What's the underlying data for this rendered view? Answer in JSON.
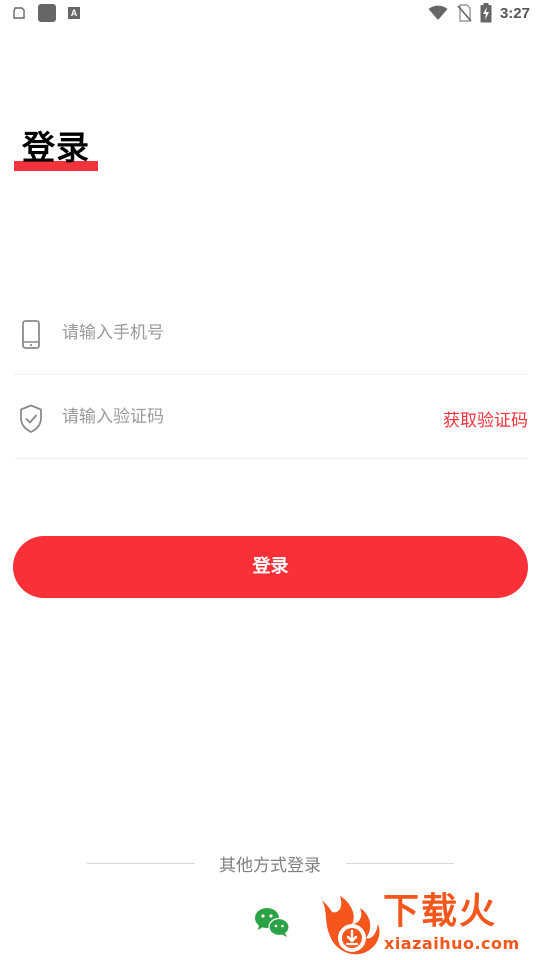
{
  "status_bar": {
    "time": "3:27",
    "left_icons": [
      "sd-card-icon",
      "app-square-icon",
      "font-a-icon"
    ],
    "right_icons": [
      "wifi-icon",
      "no-sim-icon",
      "battery-charging-icon"
    ],
    "a_glyph": "A"
  },
  "page": {
    "title": "登录",
    "accent_color": "#f4323c"
  },
  "form": {
    "phone": {
      "placeholder": "请输入手机号",
      "value": "",
      "icon": "phone-icon"
    },
    "code": {
      "placeholder": "请输入验证码",
      "value": "",
      "icon": "shield-check-icon",
      "get_code_label": "获取验证码"
    },
    "login_label": "登录"
  },
  "other_login": {
    "label": "其他方式登录",
    "methods": [
      {
        "icon": "wechat-icon"
      }
    ]
  },
  "watermark": {
    "name": "下载火",
    "url": "xiazaihuo.com",
    "color": "#f4561b"
  }
}
